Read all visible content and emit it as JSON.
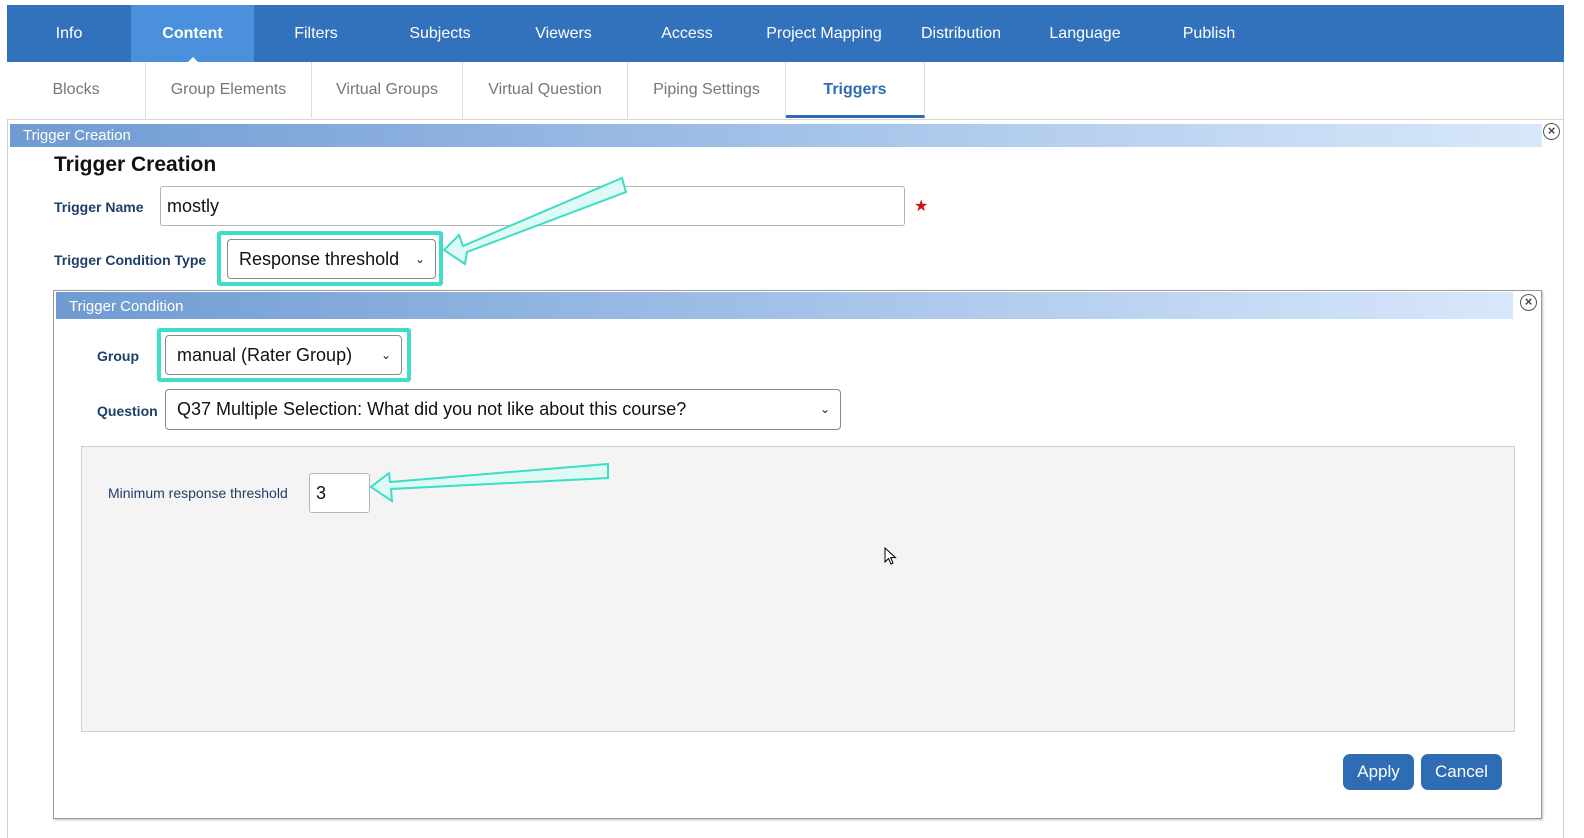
{
  "top_nav": {
    "tabs": [
      "Info",
      "Content",
      "Filters",
      "Subjects",
      "Viewers",
      "Access",
      "Project Mapping",
      "Distribution",
      "Language",
      "Publish"
    ],
    "active": "Content"
  },
  "sub_nav": {
    "tabs": [
      "Blocks",
      "Group Elements",
      "Virtual Groups",
      "Virtual Question",
      "Piping Settings",
      "Triggers"
    ],
    "active": "Triggers"
  },
  "trigger_panel": {
    "bar_title": "Trigger Creation",
    "heading": "Trigger Creation",
    "name_label": "Trigger Name",
    "name_value": "mostly",
    "required_mark": "★",
    "condition_type_label": "Trigger Condition Type",
    "condition_type_value": "Response threshold"
  },
  "condition_panel": {
    "bar_title": "Trigger Condition",
    "group_label": "Group",
    "group_value": "manual (Rater Group)",
    "question_label": "Question",
    "question_value": "Q37 Multiple Selection: What did you not like about this course?",
    "min_threshold_label": "Minimum response threshold",
    "min_threshold_value": "3",
    "apply_label": "Apply",
    "cancel_label": "Cancel"
  },
  "icons": {
    "close": "close-circle-icon",
    "dropdown": "chevron-down-icon"
  },
  "colors": {
    "nav": "#3272bd",
    "nav_active": "#4a90dc",
    "highlight": "#3fdcc8",
    "button": "#2e6cb3",
    "required": "#cc1111"
  }
}
